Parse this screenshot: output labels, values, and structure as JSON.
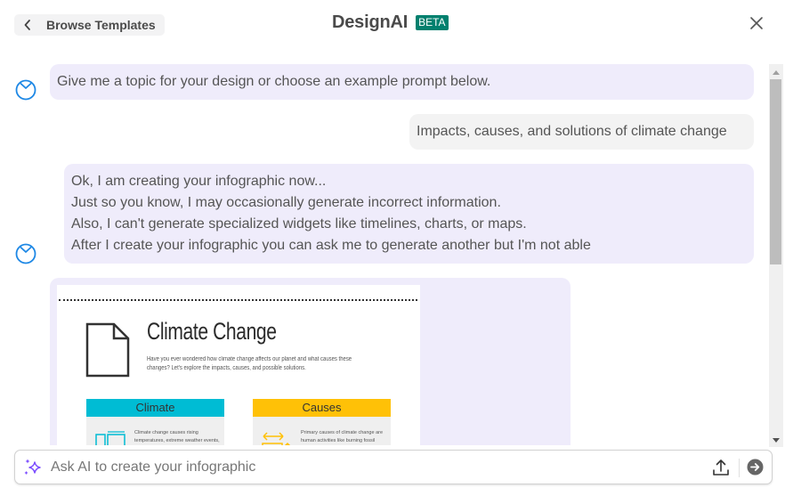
{
  "header": {
    "back_label": "Browse Templates",
    "title": "DesignAI",
    "badge": "BETA",
    "icons": {
      "back": "chevron-left-icon",
      "close": "close-icon"
    }
  },
  "messages": [
    {
      "role": "assistant",
      "text": "Give me a topic for your design or choose an example prompt below."
    },
    {
      "role": "user",
      "text": "Impacts, causes, and solutions of climate change"
    },
    {
      "role": "assistant",
      "lines": [
        "Ok, I am creating your infographic now...",
        "Just so you know, I may occasionally generate incorrect information.",
        "Also, I can't generate specialized widgets like timelines, charts, or maps.",
        "After I create your infographic you can ask me to generate another but I'm not able"
      ]
    },
    {
      "role": "assistant",
      "type": "infographic-preview"
    }
  ],
  "infographic": {
    "title": "Climate Change",
    "subtitle": "Have you ever wondered how climate change affects our planet and what causes these changes? Let's explore the impacts, causes, and possible solutions.",
    "cards": [
      {
        "title": "Climate",
        "color": "#00bcd4",
        "text": "Climate change causes rising temperatures, extreme weather events, sea level rise, and biodiversity loss."
      },
      {
        "title": "Causes",
        "color": "#ffc107",
        "text": "Primary causes of climate change are human activities like burning fossil fuels, deforestation, and industrial processes."
      }
    ]
  },
  "composer": {
    "placeholder": "Ask AI to create your infographic",
    "value": "",
    "icons": {
      "sparkle": "sparkle-icon",
      "upload": "upload-icon",
      "send": "send-arrow-icon"
    }
  },
  "colors": {
    "accent": "#00806e",
    "bot_bubble": "#efecfb",
    "user_bubble": "#f3f3f3",
    "bot_icon": "#1e88e5",
    "sparkle": "#7c4dff"
  }
}
